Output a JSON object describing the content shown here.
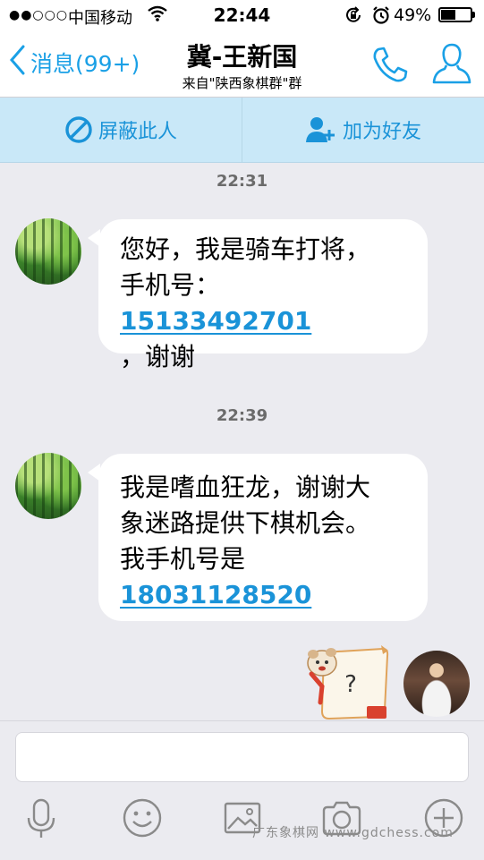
{
  "status_bar": {
    "signal": "●●○○○",
    "carrier": "中国移动",
    "time": "22:44",
    "battery_percent": "49%",
    "battery_level": 0.49
  },
  "nav": {
    "back_label": "消息(99+)",
    "title": "冀-王新国",
    "subtitle": "来自\"陕西象棋群\"群"
  },
  "actions": {
    "block_label": "屏蔽此人",
    "add_friend_label": "加为好友"
  },
  "messages": [
    {
      "time": "22:31",
      "line1": "您好，我是骑车打将，",
      "line2_prefix": "手机号：",
      "phone": "15133492701",
      "line3": "，谢谢"
    },
    {
      "time": "22:39",
      "line1": "我是嗜血狂龙，谢谢大",
      "line2": "象迷路提供下棋机会。",
      "line3": "我手机号是",
      "phone": "18031128520"
    }
  ],
  "sticker": {
    "glyph": "?"
  },
  "input": {
    "value": ""
  },
  "watermark": "广东象棋网 www.gdchess.com",
  "colors": {
    "accent": "#1aa0e6",
    "action_bar": "#c9e8f8",
    "background": "#ebebf0"
  }
}
